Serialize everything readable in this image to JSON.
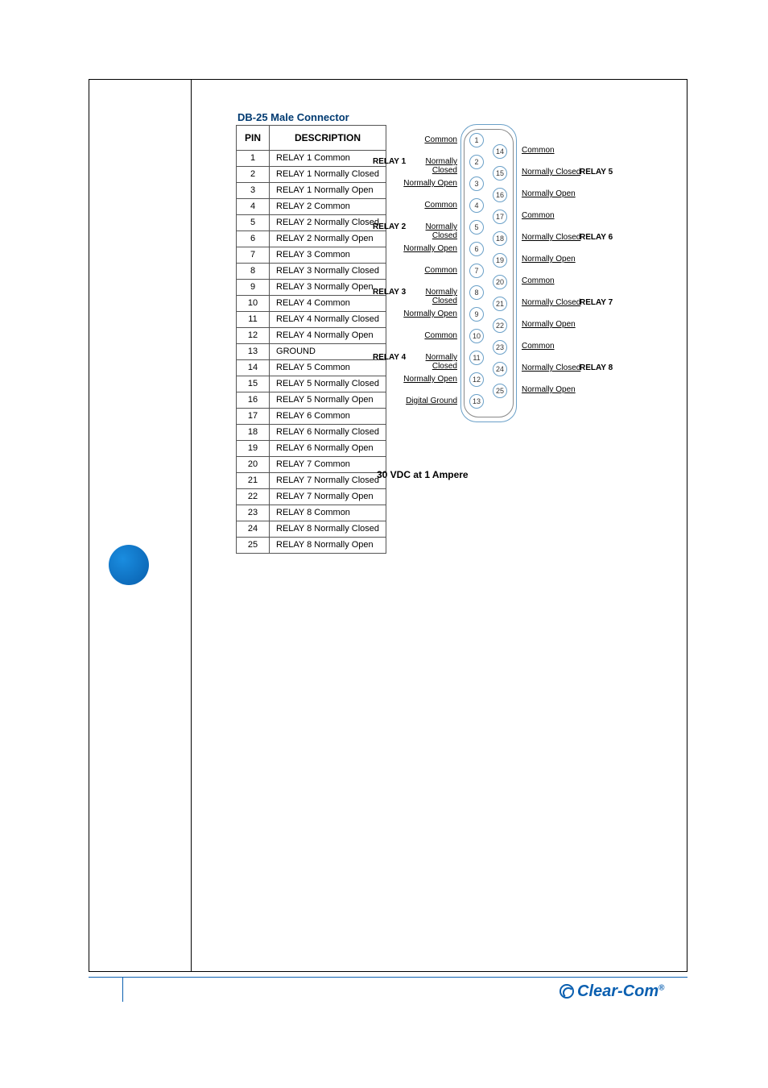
{
  "title": "DB-25 Male Connector",
  "table": {
    "headers": [
      "PIN",
      "DESCRIPTION"
    ],
    "rows": [
      {
        "pin": "1",
        "desc": "RELAY 1 Common"
      },
      {
        "pin": "2",
        "desc": "RELAY 1 Normally Closed"
      },
      {
        "pin": "3",
        "desc": "RELAY 1 Normally Open"
      },
      {
        "pin": "4",
        "desc": "RELAY 2 Common"
      },
      {
        "pin": "5",
        "desc": "RELAY 2 Normally Closed"
      },
      {
        "pin": "6",
        "desc": "RELAY 2 Normally Open"
      },
      {
        "pin": "7",
        "desc": "RELAY 3 Common"
      },
      {
        "pin": "8",
        "desc": "RELAY 3 Normally Closed"
      },
      {
        "pin": "9",
        "desc": "RELAY 3 Normally Open"
      },
      {
        "pin": "10",
        "desc": "RELAY 4 Common"
      },
      {
        "pin": "11",
        "desc": "RELAY 4 Normally Closed"
      },
      {
        "pin": "12",
        "desc": "RELAY 4 Normally Open"
      },
      {
        "pin": "13",
        "desc": "GROUND"
      },
      {
        "pin": "14",
        "desc": "RELAY 5 Common"
      },
      {
        "pin": "15",
        "desc": "RELAY 5 Normally Closed"
      },
      {
        "pin": "16",
        "desc": "RELAY 5 Normally Open"
      },
      {
        "pin": "17",
        "desc": "RELAY 6 Common"
      },
      {
        "pin": "18",
        "desc": "RELAY 6 Normally Closed"
      },
      {
        "pin": "19",
        "desc": "RELAY 6 Normally Open"
      },
      {
        "pin": "20",
        "desc": "RELAY 7 Common"
      },
      {
        "pin": "21",
        "desc": "RELAY 7 Normally Closed"
      },
      {
        "pin": "22",
        "desc": "RELAY 7 Normally Open"
      },
      {
        "pin": "23",
        "desc": "RELAY 8 Common"
      },
      {
        "pin": "24",
        "desc": "RELAY 8 Normally Closed"
      },
      {
        "pin": "25",
        "desc": "RELAY 8 Normally Open"
      }
    ]
  },
  "diagram": {
    "left_relays": [
      "RELAY 1",
      "RELAY 2",
      "RELAY 3",
      "RELAY 4"
    ],
    "right_relays": [
      "RELAY 5",
      "RELAY 6",
      "RELAY 7",
      "RELAY 8"
    ],
    "signals_left": [
      "Common",
      "Normally Closed",
      "Normally Open",
      "Common",
      "Normally Closed",
      "Normally Open",
      "Common",
      "Normally Closed",
      "Normally Open",
      "Common",
      "Normally Closed",
      "Normally Open",
      "Digital Ground"
    ],
    "signals_right": [
      "Common",
      "Normally Closed",
      "Normally Open",
      "Common",
      "Normally Closed",
      "Normally Open",
      "Common",
      "Normally Closed",
      "Normally Open",
      "Common",
      "Normally Closed",
      "Normally Open"
    ],
    "left_pins": [
      "1",
      "2",
      "3",
      "4",
      "5",
      "6",
      "7",
      "8",
      "9",
      "10",
      "11",
      "12",
      "13"
    ],
    "right_pins": [
      "14",
      "15",
      "16",
      "17",
      "18",
      "19",
      "20",
      "21",
      "22",
      "23",
      "24",
      "25"
    ]
  },
  "rating": "30 VDC at 1 Ampere",
  "footer": {
    "brand": "Clear-Com",
    "reg": "®"
  }
}
